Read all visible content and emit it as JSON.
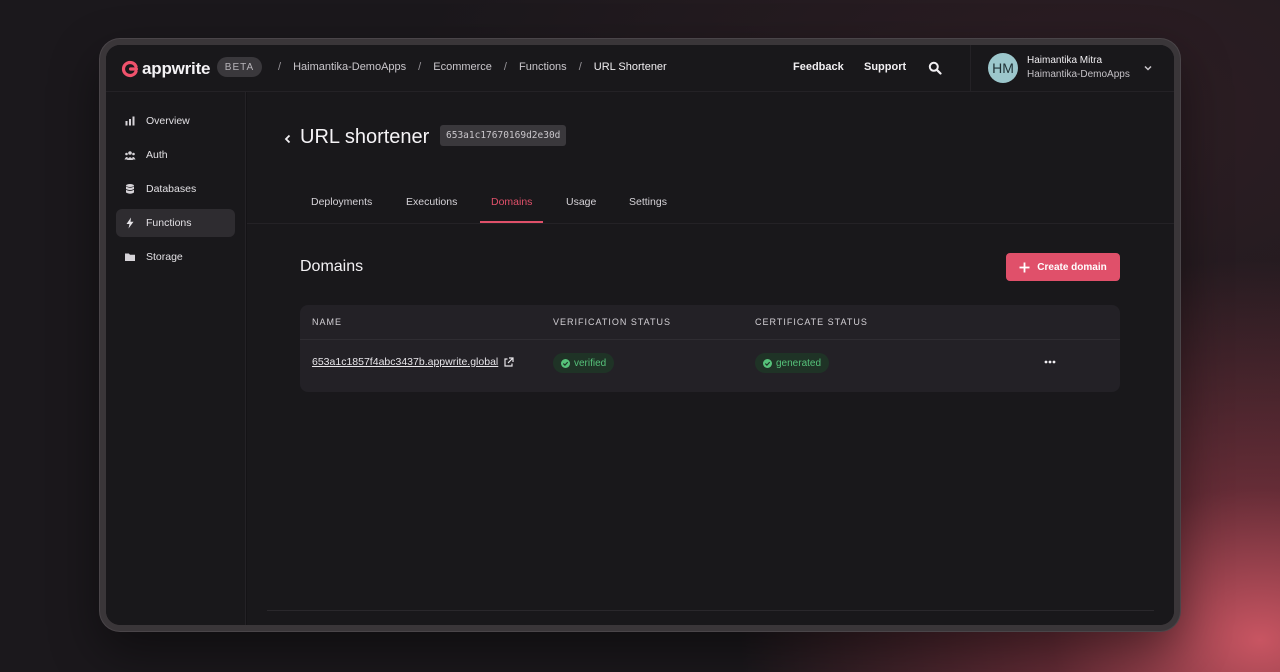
{
  "brand": {
    "name": "appwrite",
    "badge": "BETA",
    "accent": "#e0506a"
  },
  "breadcrumbs": [
    "Haimantika-DemoApps",
    "Ecommerce",
    "Functions",
    "URL Shortener"
  ],
  "header": {
    "feedback": "Feedback",
    "support": "Support",
    "search_icon": "search-icon"
  },
  "user": {
    "initials": "HM",
    "name": "Haimantika Mitra",
    "org": "Haimantika-DemoApps"
  },
  "sidebar": {
    "items": [
      {
        "label": "Overview",
        "icon": "bar-chart-icon"
      },
      {
        "label": "Auth",
        "icon": "users-icon"
      },
      {
        "label": "Databases",
        "icon": "database-icon"
      },
      {
        "label": "Functions",
        "icon": "lightning-icon",
        "active": true
      },
      {
        "label": "Storage",
        "icon": "folder-icon"
      }
    ]
  },
  "page": {
    "title": "URL shortener",
    "function_id": "653a1c17670169d2e30d"
  },
  "tabs": [
    {
      "label": "Deployments"
    },
    {
      "label": "Executions"
    },
    {
      "label": "Domains",
      "active": true
    },
    {
      "label": "Usage"
    },
    {
      "label": "Settings"
    }
  ],
  "section": {
    "title": "Domains",
    "create_label": "Create domain"
  },
  "table": {
    "columns": [
      "NAME",
      "VERIFICATION STATUS",
      "CERTIFICATE STATUS"
    ],
    "rows": [
      {
        "name": "653a1c1857f4abc3437b.appwrite.global",
        "verification": "verified",
        "certificate": "generated"
      }
    ]
  }
}
